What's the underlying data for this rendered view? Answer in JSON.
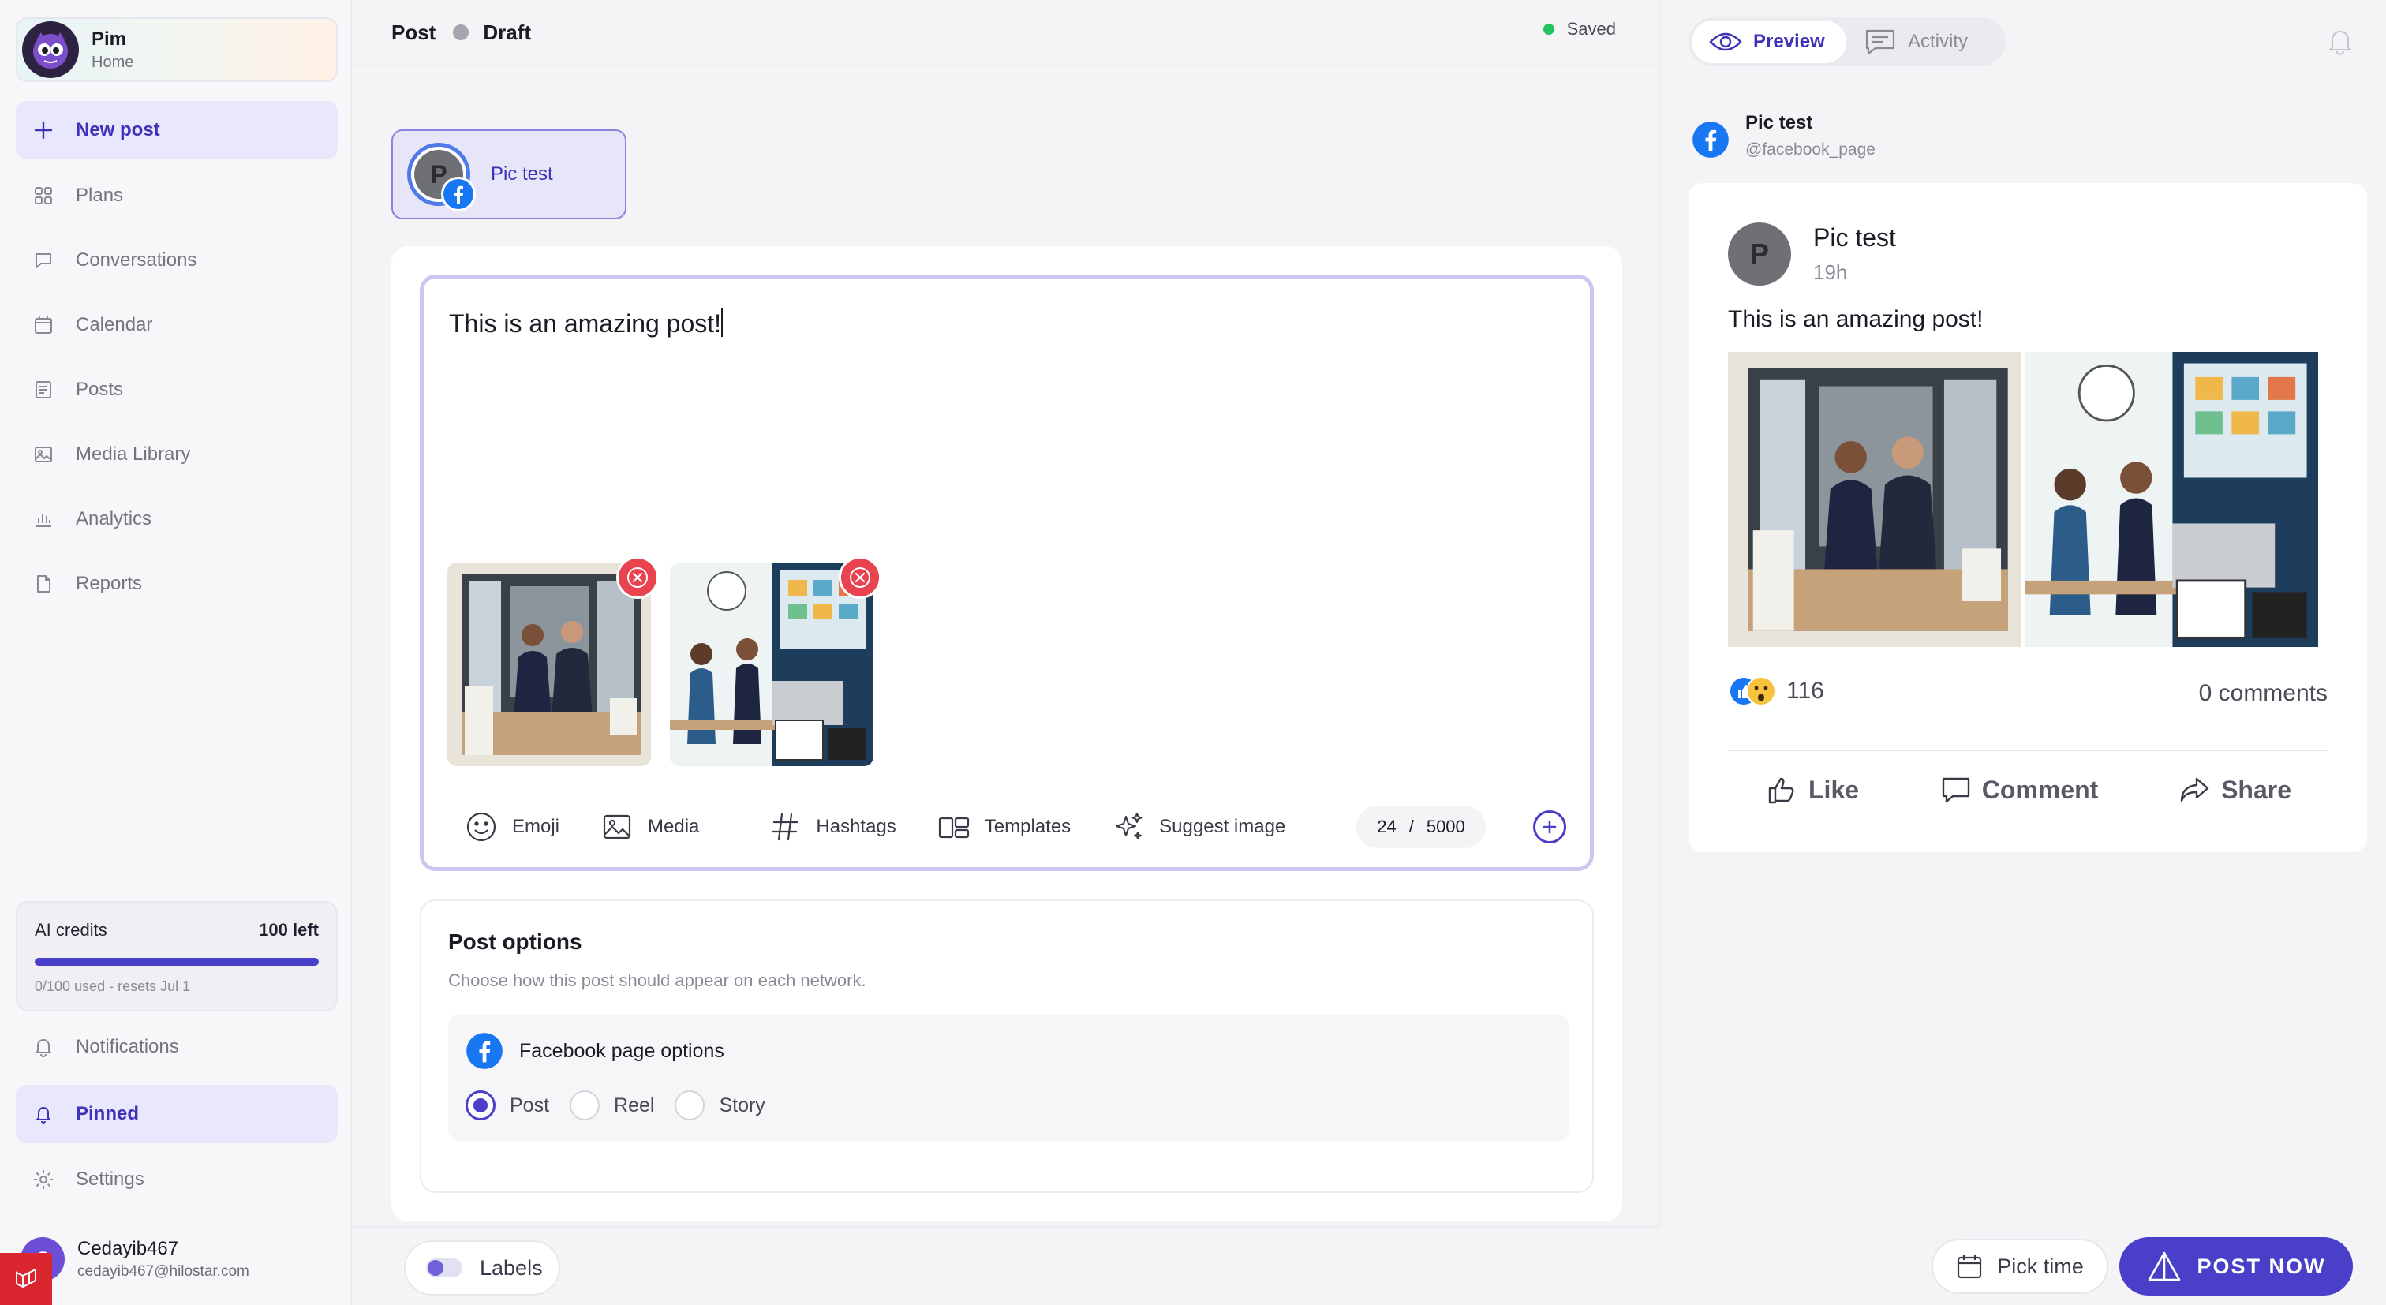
{
  "workspace": {
    "name": "Pim",
    "subtitle": "Home"
  },
  "nav": {
    "items": [
      {
        "label": "New post",
        "icon": "plus-icon"
      },
      {
        "label": "Plans",
        "icon": "grid-icon"
      },
      {
        "label": "Conversations",
        "icon": "chat-icon"
      },
      {
        "label": "Calendar",
        "icon": "calendar-icon"
      },
      {
        "label": "Posts",
        "icon": "document-icon"
      },
      {
        "label": "Media Library",
        "icon": "image-icon"
      },
      {
        "label": "Analytics",
        "icon": "bar-chart-icon"
      },
      {
        "label": "Reports",
        "icon": "file-icon"
      }
    ],
    "notifications": "Notifications",
    "pinned": "Pinned",
    "settings": "Settings"
  },
  "credits": {
    "label": "AI credits",
    "left": "100 left",
    "usage": "0/100 used - resets Jul 1",
    "fraction_left": 1.0
  },
  "user": {
    "initial": "C",
    "name": "Cedayib467",
    "email": "cedayib467@hilostar.com"
  },
  "editor": {
    "crumb_post": "Post",
    "crumb_draft": "Draft",
    "saved": "Saved",
    "account": {
      "initial": "P",
      "name": "Pic test"
    },
    "text": "This is an amazing post!",
    "tools": {
      "emoji": "Emoji",
      "media": "Media",
      "hashtags": "Hashtags",
      "templates": "Templates",
      "suggest": "Suggest image"
    },
    "counter": {
      "used": "24",
      "sep": "/",
      "max": "5000"
    },
    "options": {
      "title": "Post options",
      "subtitle": "Choose how this post should appear on each network.",
      "facebook_title": "Facebook page options",
      "types": [
        "Post",
        "Reel",
        "Story"
      ],
      "selected": "Post"
    },
    "labels_button": "Labels"
  },
  "preview": {
    "tab_preview": "Preview",
    "tab_activity": "Activity",
    "account_name": "Pic test",
    "account_handle": "@facebook_page",
    "post": {
      "initial": "P",
      "name": "Pic test",
      "time": "19h",
      "text": "This is an amazing post!",
      "reactions": "116",
      "comments": "0 comments",
      "like": "Like",
      "comment": "Comment",
      "share": "Share"
    },
    "pick_time": "Pick time",
    "post_now": "POST NOW"
  },
  "colors": {
    "accent": "#4a3fc9",
    "facebook": "#1877f2",
    "remove": "#e8434e",
    "saved": "#22c35e"
  }
}
